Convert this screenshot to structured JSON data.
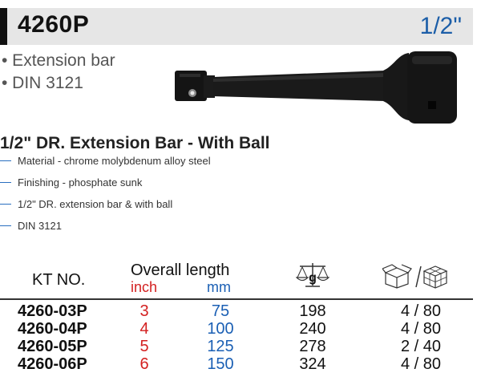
{
  "header": {
    "model": "4260P",
    "size": "1/2\""
  },
  "bullets": [
    "• Extension bar",
    "• DIN 3121"
  ],
  "title": "1/2\" DR. Extension Bar - With Ball",
  "features": [
    "Material - chrome molybdenum alloy steel",
    "Finishing - phosphate sunk",
    "1/2\" DR. extension bar & with ball",
    "DIN 3121"
  ],
  "table": {
    "kt_header": "KT NO.",
    "length_header": "Overall length",
    "inch_header": "inch",
    "mm_header": "mm",
    "weight_icon": "scale-g-icon",
    "weight_unit": "g",
    "packing_icon": "box-cube-icon",
    "rows": [
      {
        "kt": "4260-03P",
        "inch": "3",
        "mm": "75",
        "weight": "198",
        "pack": "4 / 80"
      },
      {
        "kt": "4260-04P",
        "inch": "4",
        "mm": "100",
        "weight": "240",
        "pack": "4 / 80"
      },
      {
        "kt": "4260-05P",
        "inch": "5",
        "mm": "125",
        "weight": "278",
        "pack": "2 / 40"
      },
      {
        "kt": "4260-06P",
        "inch": "6",
        "mm": "150",
        "weight": "324",
        "pack": "4 / 80"
      }
    ]
  },
  "colors": {
    "accent_blue": "#1c5ea8",
    "inch_red": "#d32020",
    "header_bg": "#e6e6e6"
  }
}
